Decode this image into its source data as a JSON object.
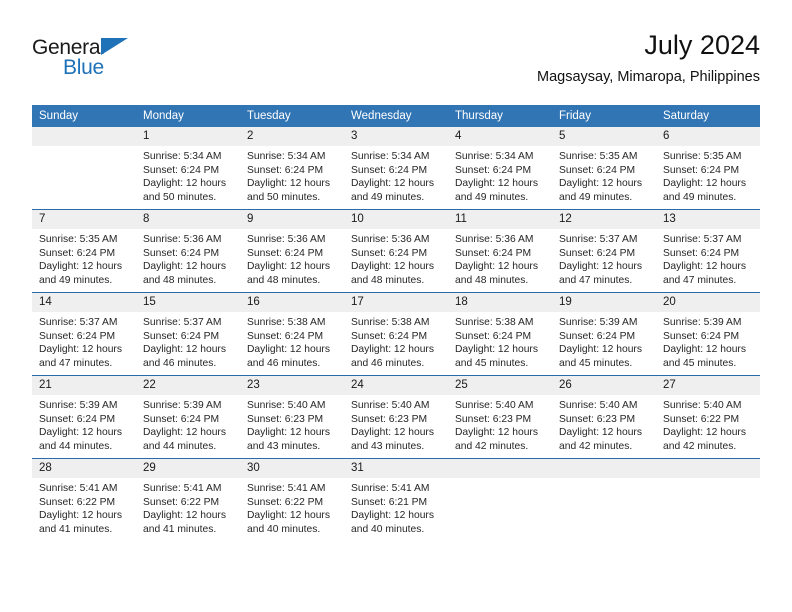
{
  "brand": {
    "name_top": "General",
    "name_bottom": "Blue",
    "accent_color": "#1f72b8"
  },
  "header": {
    "title": "July 2024",
    "subtitle": "Magsaysay, Mimaropa, Philippines"
  },
  "theme": {
    "header_blue": "#3275b5",
    "row_divider_blue": "#2b6ca8",
    "daynum_band": "#efefef",
    "text": "#262626"
  },
  "calendar": {
    "weekday_headers": [
      "Sunday",
      "Monday",
      "Tuesday",
      "Wednesday",
      "Thursday",
      "Friday",
      "Saturday"
    ],
    "weeks": [
      [
        {
          "day": "",
          "sunrise": "",
          "sunset": "",
          "daylight_line1": "",
          "daylight_line2": ""
        },
        {
          "day": "1",
          "sunrise": "Sunrise: 5:34 AM",
          "sunset": "Sunset: 6:24 PM",
          "daylight_line1": "Daylight: 12 hours",
          "daylight_line2": "and 50 minutes."
        },
        {
          "day": "2",
          "sunrise": "Sunrise: 5:34 AM",
          "sunset": "Sunset: 6:24 PM",
          "daylight_line1": "Daylight: 12 hours",
          "daylight_line2": "and 50 minutes."
        },
        {
          "day": "3",
          "sunrise": "Sunrise: 5:34 AM",
          "sunset": "Sunset: 6:24 PM",
          "daylight_line1": "Daylight: 12 hours",
          "daylight_line2": "and 49 minutes."
        },
        {
          "day": "4",
          "sunrise": "Sunrise: 5:34 AM",
          "sunset": "Sunset: 6:24 PM",
          "daylight_line1": "Daylight: 12 hours",
          "daylight_line2": "and 49 minutes."
        },
        {
          "day": "5",
          "sunrise": "Sunrise: 5:35 AM",
          "sunset": "Sunset: 6:24 PM",
          "daylight_line1": "Daylight: 12 hours",
          "daylight_line2": "and 49 minutes."
        },
        {
          "day": "6",
          "sunrise": "Sunrise: 5:35 AM",
          "sunset": "Sunset: 6:24 PM",
          "daylight_line1": "Daylight: 12 hours",
          "daylight_line2": "and 49 minutes."
        }
      ],
      [
        {
          "day": "7",
          "sunrise": "Sunrise: 5:35 AM",
          "sunset": "Sunset: 6:24 PM",
          "daylight_line1": "Daylight: 12 hours",
          "daylight_line2": "and 49 minutes."
        },
        {
          "day": "8",
          "sunrise": "Sunrise: 5:36 AM",
          "sunset": "Sunset: 6:24 PM",
          "daylight_line1": "Daylight: 12 hours",
          "daylight_line2": "and 48 minutes."
        },
        {
          "day": "9",
          "sunrise": "Sunrise: 5:36 AM",
          "sunset": "Sunset: 6:24 PM",
          "daylight_line1": "Daylight: 12 hours",
          "daylight_line2": "and 48 minutes."
        },
        {
          "day": "10",
          "sunrise": "Sunrise: 5:36 AM",
          "sunset": "Sunset: 6:24 PM",
          "daylight_line1": "Daylight: 12 hours",
          "daylight_line2": "and 48 minutes."
        },
        {
          "day": "11",
          "sunrise": "Sunrise: 5:36 AM",
          "sunset": "Sunset: 6:24 PM",
          "daylight_line1": "Daylight: 12 hours",
          "daylight_line2": "and 48 minutes."
        },
        {
          "day": "12",
          "sunrise": "Sunrise: 5:37 AM",
          "sunset": "Sunset: 6:24 PM",
          "daylight_line1": "Daylight: 12 hours",
          "daylight_line2": "and 47 minutes."
        },
        {
          "day": "13",
          "sunrise": "Sunrise: 5:37 AM",
          "sunset": "Sunset: 6:24 PM",
          "daylight_line1": "Daylight: 12 hours",
          "daylight_line2": "and 47 minutes."
        }
      ],
      [
        {
          "day": "14",
          "sunrise": "Sunrise: 5:37 AM",
          "sunset": "Sunset: 6:24 PM",
          "daylight_line1": "Daylight: 12 hours",
          "daylight_line2": "and 47 minutes."
        },
        {
          "day": "15",
          "sunrise": "Sunrise: 5:37 AM",
          "sunset": "Sunset: 6:24 PM",
          "daylight_line1": "Daylight: 12 hours",
          "daylight_line2": "and 46 minutes."
        },
        {
          "day": "16",
          "sunrise": "Sunrise: 5:38 AM",
          "sunset": "Sunset: 6:24 PM",
          "daylight_line1": "Daylight: 12 hours",
          "daylight_line2": "and 46 minutes."
        },
        {
          "day": "17",
          "sunrise": "Sunrise: 5:38 AM",
          "sunset": "Sunset: 6:24 PM",
          "daylight_line1": "Daylight: 12 hours",
          "daylight_line2": "and 46 minutes."
        },
        {
          "day": "18",
          "sunrise": "Sunrise: 5:38 AM",
          "sunset": "Sunset: 6:24 PM",
          "daylight_line1": "Daylight: 12 hours",
          "daylight_line2": "and 45 minutes."
        },
        {
          "day": "19",
          "sunrise": "Sunrise: 5:39 AM",
          "sunset": "Sunset: 6:24 PM",
          "daylight_line1": "Daylight: 12 hours",
          "daylight_line2": "and 45 minutes."
        },
        {
          "day": "20",
          "sunrise": "Sunrise: 5:39 AM",
          "sunset": "Sunset: 6:24 PM",
          "daylight_line1": "Daylight: 12 hours",
          "daylight_line2": "and 45 minutes."
        }
      ],
      [
        {
          "day": "21",
          "sunrise": "Sunrise: 5:39 AM",
          "sunset": "Sunset: 6:24 PM",
          "daylight_line1": "Daylight: 12 hours",
          "daylight_line2": "and 44 minutes."
        },
        {
          "day": "22",
          "sunrise": "Sunrise: 5:39 AM",
          "sunset": "Sunset: 6:24 PM",
          "daylight_line1": "Daylight: 12 hours",
          "daylight_line2": "and 44 minutes."
        },
        {
          "day": "23",
          "sunrise": "Sunrise: 5:40 AM",
          "sunset": "Sunset: 6:23 PM",
          "daylight_line1": "Daylight: 12 hours",
          "daylight_line2": "and 43 minutes."
        },
        {
          "day": "24",
          "sunrise": "Sunrise: 5:40 AM",
          "sunset": "Sunset: 6:23 PM",
          "daylight_line1": "Daylight: 12 hours",
          "daylight_line2": "and 43 minutes."
        },
        {
          "day": "25",
          "sunrise": "Sunrise: 5:40 AM",
          "sunset": "Sunset: 6:23 PM",
          "daylight_line1": "Daylight: 12 hours",
          "daylight_line2": "and 42 minutes."
        },
        {
          "day": "26",
          "sunrise": "Sunrise: 5:40 AM",
          "sunset": "Sunset: 6:23 PM",
          "daylight_line1": "Daylight: 12 hours",
          "daylight_line2": "and 42 minutes."
        },
        {
          "day": "27",
          "sunrise": "Sunrise: 5:40 AM",
          "sunset": "Sunset: 6:22 PM",
          "daylight_line1": "Daylight: 12 hours",
          "daylight_line2": "and 42 minutes."
        }
      ],
      [
        {
          "day": "28",
          "sunrise": "Sunrise: 5:41 AM",
          "sunset": "Sunset: 6:22 PM",
          "daylight_line1": "Daylight: 12 hours",
          "daylight_line2": "and 41 minutes."
        },
        {
          "day": "29",
          "sunrise": "Sunrise: 5:41 AM",
          "sunset": "Sunset: 6:22 PM",
          "daylight_line1": "Daylight: 12 hours",
          "daylight_line2": "and 41 minutes."
        },
        {
          "day": "30",
          "sunrise": "Sunrise: 5:41 AM",
          "sunset": "Sunset: 6:22 PM",
          "daylight_line1": "Daylight: 12 hours",
          "daylight_line2": "and 40 minutes."
        },
        {
          "day": "31",
          "sunrise": "Sunrise: 5:41 AM",
          "sunset": "Sunset: 6:21 PM",
          "daylight_line1": "Daylight: 12 hours",
          "daylight_line2": "and 40 minutes."
        },
        {
          "day": "",
          "sunrise": "",
          "sunset": "",
          "daylight_line1": "",
          "daylight_line2": ""
        },
        {
          "day": "",
          "sunrise": "",
          "sunset": "",
          "daylight_line1": "",
          "daylight_line2": ""
        },
        {
          "day": "",
          "sunrise": "",
          "sunset": "",
          "daylight_line1": "",
          "daylight_line2": ""
        }
      ]
    ]
  }
}
